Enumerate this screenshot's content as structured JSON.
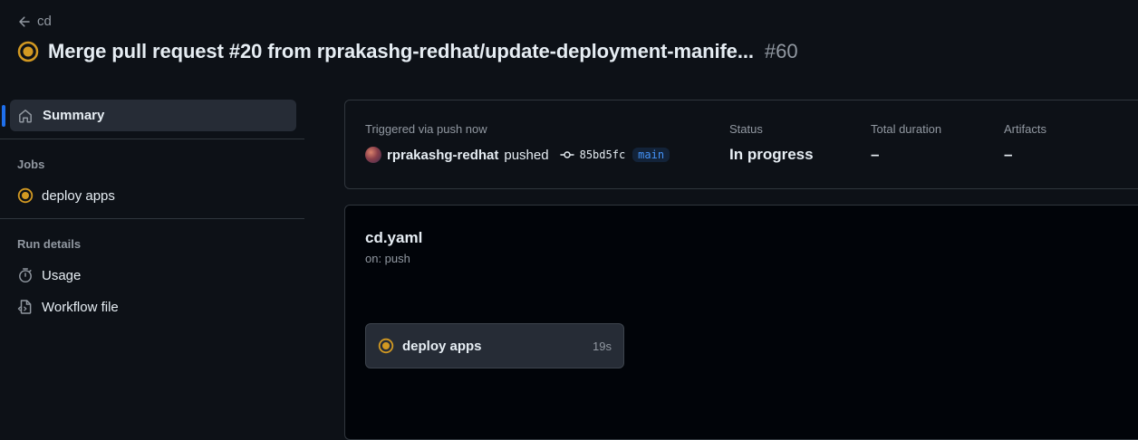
{
  "header": {
    "back_label": "cd",
    "title": "Merge pull request #20 from rprakashg-redhat/update-deployment-manife...",
    "run_number": "#60",
    "status_color": "#d29922"
  },
  "sidebar": {
    "summary_label": "Summary",
    "jobs_heading": "Jobs",
    "jobs": [
      {
        "label": "deploy apps"
      }
    ],
    "run_details_heading": "Run details",
    "run_details": [
      {
        "label": "Usage"
      },
      {
        "label": "Workflow file"
      }
    ]
  },
  "summary": {
    "triggered_label": "Triggered via push now",
    "actor": "rprakashg-redhat",
    "action": "pushed",
    "commit_sha": "85bd5fc",
    "branch": "main",
    "status_label": "Status",
    "status_value": "In progress",
    "duration_label": "Total duration",
    "duration_value": "–",
    "artifacts_label": "Artifacts",
    "artifacts_value": "–"
  },
  "workflow": {
    "file_name": "cd.yaml",
    "trigger": "on: push",
    "jobs": [
      {
        "label": "deploy apps",
        "duration": "19s"
      }
    ]
  },
  "colors": {
    "accent": "#1f6feb",
    "in_progress": "#d29922",
    "background": "#0d1117"
  }
}
